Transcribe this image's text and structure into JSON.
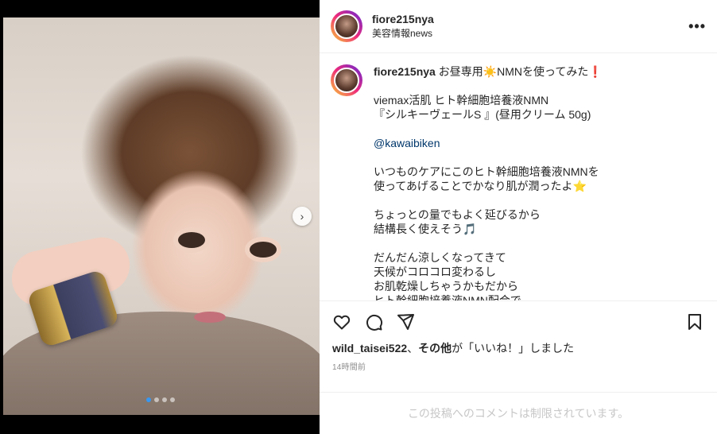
{
  "post": {
    "username": "fiore215nya",
    "location": "美容情報news",
    "more_icon": "more-horizontal-icon"
  },
  "caption": {
    "username": "fiore215nya",
    "first_line": " お昼専用☀️NMNを使ってみた❗️",
    "lines": [
      "",
      "viemax活肌 ヒト幹細胞培養液NMN",
      "『シルキーヴェールS 』(昼用クリーム 50g)",
      "",
      "@kawaibiken",
      "",
      "いつものケアにこのヒト幹細胞培養液NMNを",
      "使ってあげることでかなり肌が潤ったよ⭐",
      "",
      "ちょっとの量でもよく延びるから",
      "結構長く使えそう🎵",
      "",
      "だんだん涼しくなってきて",
      "天候がコロコロ変わるし",
      "お肌乾燥しちゃうかもだから",
      "ヒト幹細胞培養液NMN配合で"
    ],
    "mention": "@kawaibiken"
  },
  "actions": {
    "like_icon": "heart-icon",
    "comment_icon": "comment-icon",
    "share_icon": "send-icon",
    "save_icon": "bookmark-icon"
  },
  "likes": {
    "user": "wild_taisei522",
    "sep": "、",
    "others": "その他",
    "suffix": "が「いいね！」しました"
  },
  "timestamp": "14時間前",
  "comments_disabled": "この投稿へのコメントは制限されています。",
  "carousel": {
    "total": 4,
    "current": 1,
    "active_color": "#3897f0"
  }
}
